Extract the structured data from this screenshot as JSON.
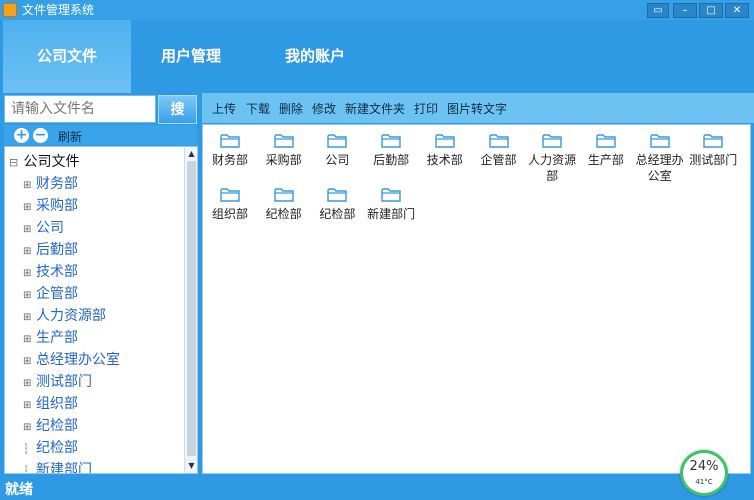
{
  "window": {
    "title": "文件管理系统",
    "controls": [
      "▭",
      "–",
      "□",
      "✕"
    ]
  },
  "nav": {
    "tabs": [
      {
        "label": "公司文件",
        "active": true
      },
      {
        "label": "用户管理",
        "active": false
      },
      {
        "label": "我的账户",
        "active": false
      }
    ]
  },
  "search": {
    "placeholder": "请输入文件名",
    "button_label": "搜"
  },
  "tree_toolbar": {
    "plus": "+",
    "minus": "−",
    "refresh_label": "刷新"
  },
  "tree": {
    "root_expander": "⊟",
    "root": "公司文件",
    "expander": "⊞",
    "items": [
      {
        "label": "财务部",
        "expandable": true
      },
      {
        "label": "采购部",
        "expandable": true
      },
      {
        "label": "公司",
        "expandable": true
      },
      {
        "label": "后勤部",
        "expandable": true
      },
      {
        "label": "技术部",
        "expandable": true
      },
      {
        "label": "企管部",
        "expandable": true
      },
      {
        "label": "人力资源部",
        "expandable": true
      },
      {
        "label": "生产部",
        "expandable": true
      },
      {
        "label": "总经理办公室",
        "expandable": true
      },
      {
        "label": "测试部门",
        "expandable": true
      },
      {
        "label": "组织部",
        "expandable": true
      },
      {
        "label": "纪检部",
        "expandable": true
      },
      {
        "label": "纪检部",
        "expandable": false
      },
      {
        "label": "新建部门",
        "expandable": false
      }
    ]
  },
  "file_toolbar": {
    "items": [
      "上传",
      "下载",
      "删除",
      "修改",
      "新建文件夹",
      "打印",
      "图片转文字"
    ]
  },
  "folders": [
    {
      "line1": "财务部",
      "line2": ""
    },
    {
      "line1": "采购部",
      "line2": ""
    },
    {
      "line1": "公司",
      "line2": ""
    },
    {
      "line1": "后勤部",
      "line2": ""
    },
    {
      "line1": "技术部",
      "line2": ""
    },
    {
      "line1": "企管部",
      "line2": ""
    },
    {
      "line1": "人力资源",
      "line2": "部"
    },
    {
      "line1": "生产部",
      "line2": ""
    },
    {
      "line1": "总经理办",
      "line2": "公室"
    },
    {
      "line1": "测试部门",
      "line2": ""
    },
    {
      "line1": "组织部",
      "line2": ""
    },
    {
      "line1": "纪检部",
      "line2": ""
    },
    {
      "line1": "纪检部",
      "line2": ""
    },
    {
      "line1": "新建部门",
      "line2": ""
    }
  ],
  "status": {
    "text": "就绪"
  },
  "widget": {
    "percent": "24%",
    "temperature": "41°C"
  },
  "colors": {
    "primary": "#2f9ae4",
    "toolbar": "#6cc3f2",
    "folder": "#3a9ad8"
  }
}
